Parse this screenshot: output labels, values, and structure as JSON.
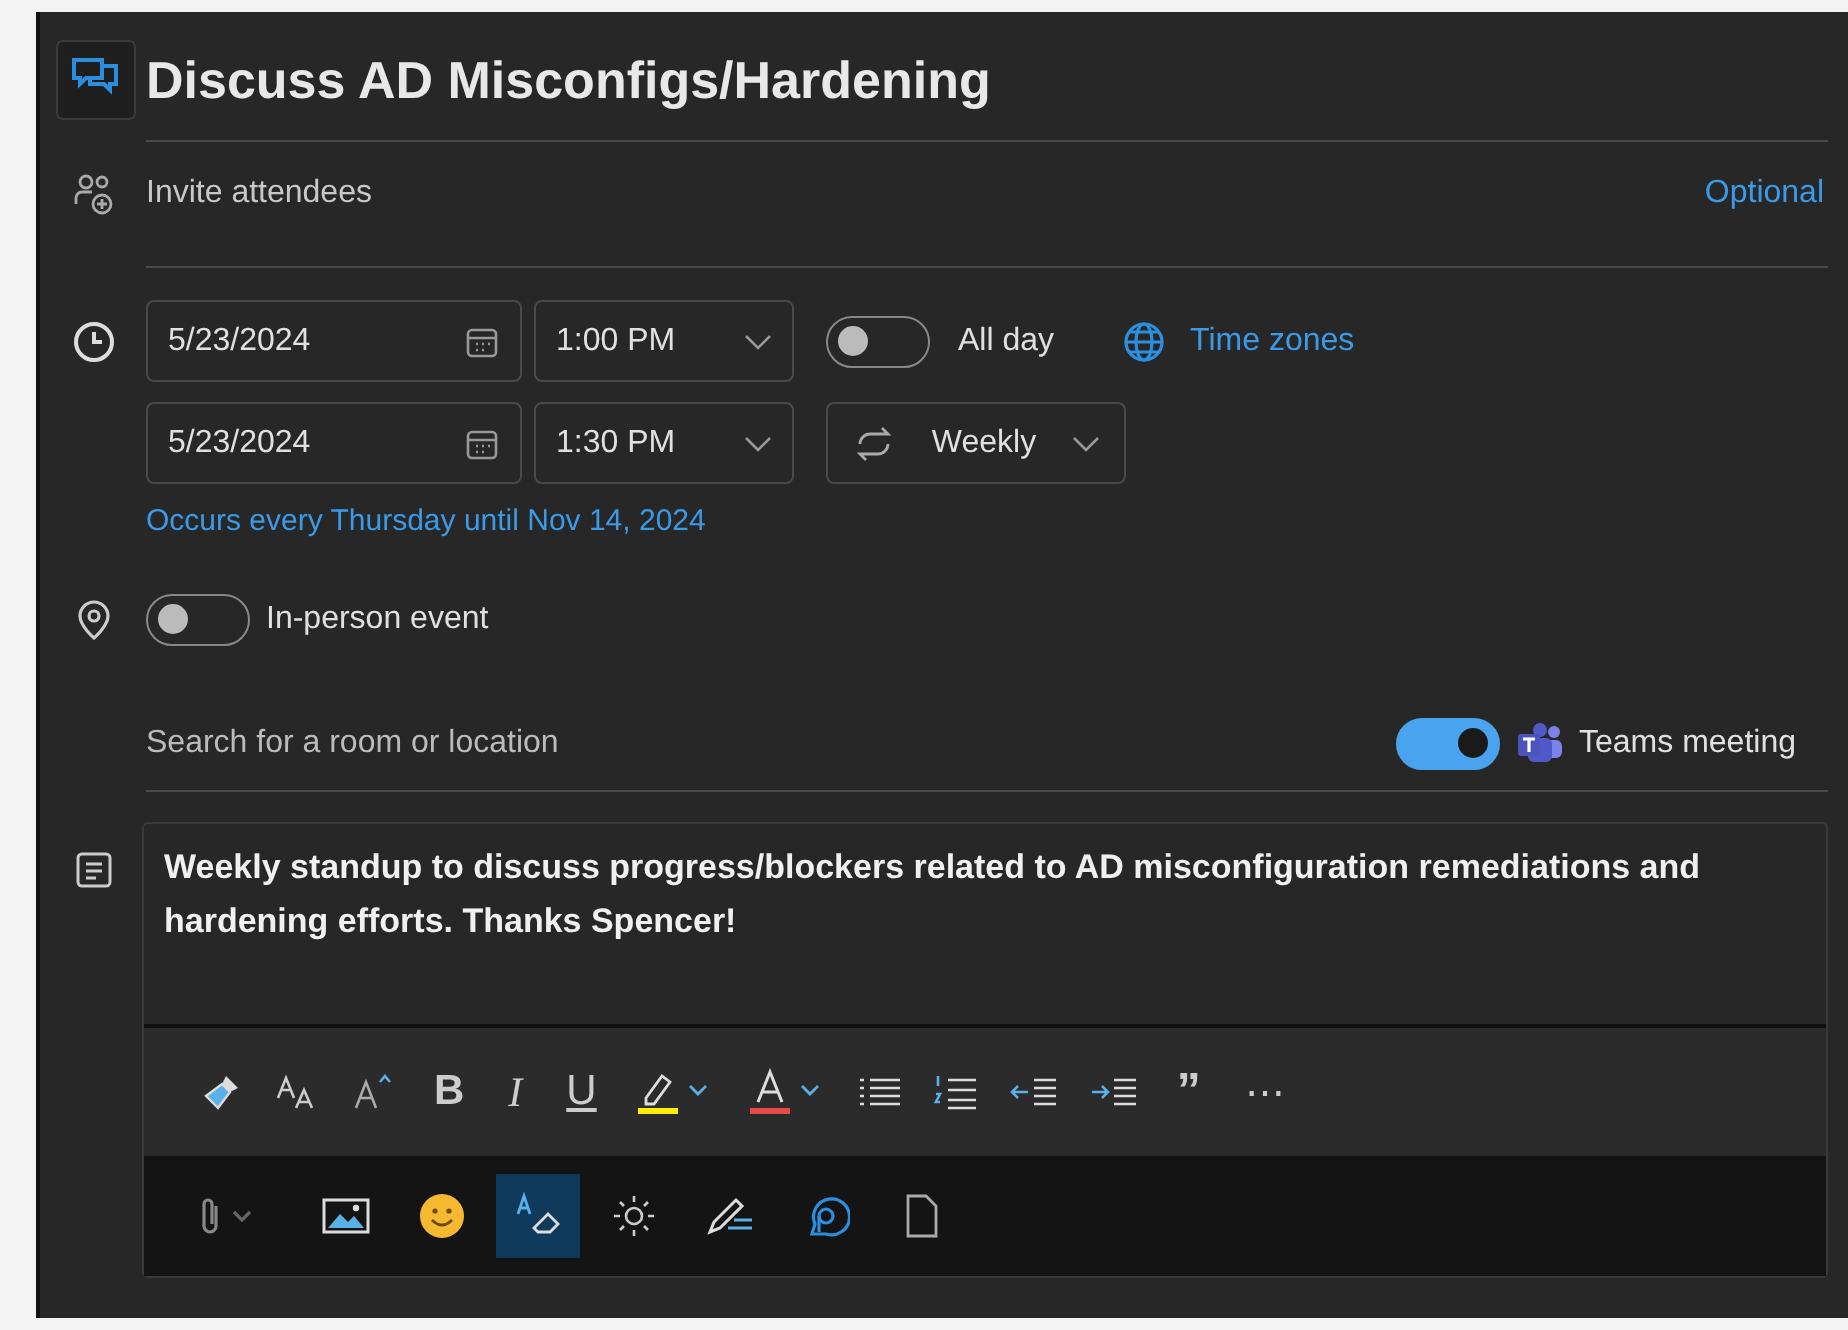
{
  "title": "Discuss AD Misconfigs/Hardening",
  "attendees": {
    "placeholder": "Invite attendees",
    "optional_link": "Optional"
  },
  "start": {
    "date": "5/23/2024",
    "time": "1:00 PM"
  },
  "end": {
    "date": "5/23/2024",
    "time": "1:30 PM"
  },
  "all_day": {
    "label": "All day",
    "on": false
  },
  "time_zones": "Time zones",
  "recurrence": {
    "label": "Weekly",
    "summary": "Occurs every Thursday until Nov 14, 2024"
  },
  "in_person": {
    "label": "In-person event",
    "on": false
  },
  "location": {
    "placeholder": "Search for a room or location"
  },
  "teams": {
    "label": "Teams meeting",
    "on": true
  },
  "body": "Weekly standup to discuss progress/blockers related to AD misconfiguration remediations and hardening efforts. Thanks Spencer!",
  "format_glyphs": [
    "B",
    "I",
    "U",
    "”",
    "⋯"
  ],
  "insert_toolbar": [
    {
      "selected": false
    },
    {
      "selected": false
    },
    {
      "selected": false
    },
    {
      "selected": true
    },
    {
      "selected": false
    },
    {
      "selected": false
    },
    {
      "selected": false
    },
    {
      "selected": false
    }
  ]
}
